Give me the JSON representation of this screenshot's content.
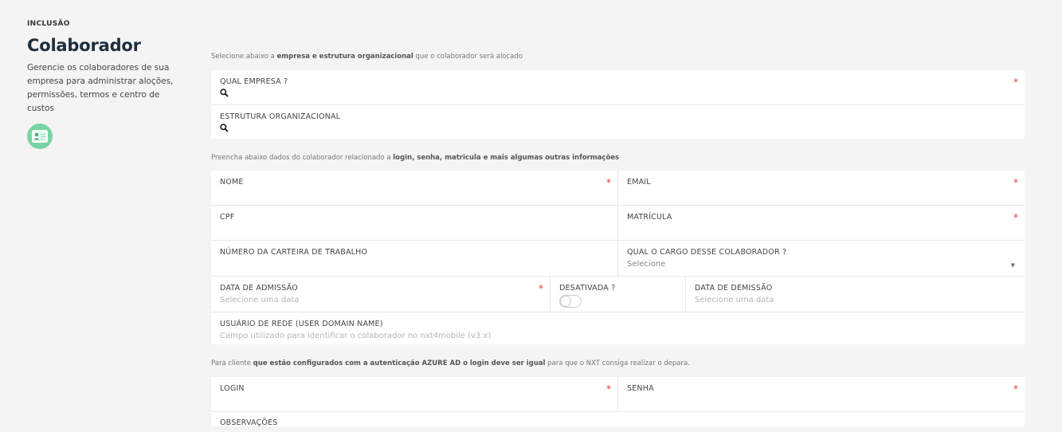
{
  "header": {
    "eyebrow": "INCLUSÃO",
    "title": "Colaborador",
    "description": "Gerencie os colaboradores de sua empresa para administrar aloções, permissões, termos e centro de custos",
    "badge_icon": "id-card-icon",
    "badge_color": "#7ad3a4"
  },
  "section1": {
    "note_pre": "Selecione abaixo a ",
    "note_bold": "empresa e estrutura organizacional",
    "note_post": " que o colaborador será alocado",
    "company_label": "QUAL EMPRESA ?",
    "org_label": "ESTRUTURA ORGANIZACIONAL"
  },
  "section2": {
    "note_pre": "Preencha abaixo dados do colaborador relacionado a ",
    "note_bold": "login, senha, matricula e mais algumas outras informações",
    "nome_label": "NOME",
    "email_label": "EMAIL",
    "cpf_label": "CPF",
    "matricula_label": "MATRÍCULA",
    "ctps_label": "NÚMERO DA CARTEIRA DE TRABALHO",
    "cargo_label": "QUAL O CARGO DESSE COLABORADOR ?",
    "cargo_value": "Selecione",
    "admissao_label": "DATA DE ADMISSÃO",
    "admissao_placeholder": "Selecione uma data",
    "desativada_label": "DESATIVADA ?",
    "desativada_on": false,
    "demissao_label": "DATA DE DEMISSÃO",
    "demissao_placeholder": "Selecione uma data",
    "usuario_label": "USUÁRIO DE REDE (USER DOMAIN NAME)",
    "usuario_placeholder": "Campo utilizado para identificar o colaborador no nxt4mobile (v3.x)"
  },
  "section3": {
    "note_pre": "Para cliente ",
    "note_bold": "que estão configurados com a autenticação AZURE AD o login deve ser igual",
    "note_post": " para que o NXT consiga realizar o depara.",
    "login_label": "LOGIN",
    "senha_label": "SENHA",
    "obs_label": "OBSERVAÇÕES"
  },
  "required_mark": "*",
  "colors": {
    "required": "#e23a3a",
    "title": "#1f2d3d"
  }
}
